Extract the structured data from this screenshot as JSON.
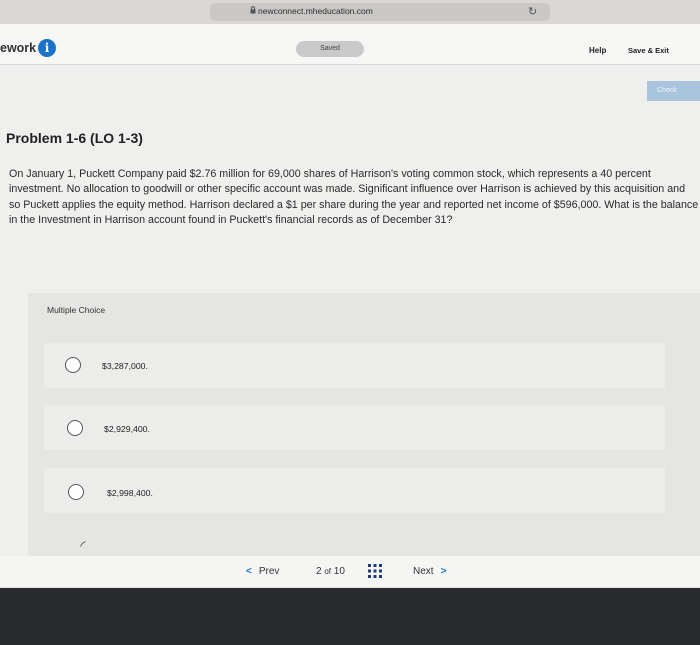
{
  "browser": {
    "url": "newconnect.mheducation.com"
  },
  "header": {
    "course_label": "ework",
    "saved_label": "Saved",
    "help_label": "Help",
    "save_exit_label": "Save & Exit",
    "check_label": "Check"
  },
  "problem": {
    "title": "Problem 1-6 (LO 1-3)",
    "text": "On January 1, Puckett Company paid $2.76 million for 69,000 shares of Harrison's voting common stock, which represents a 40 percent investment. No allocation to goodwill or other specific account was made. Significant influence over Harrison is achieved by this acquisition and so Puckett applies the equity method. Harrison declared a $1 per share during the year and reported net income of $596,000. What is the balance in the Investment in Harrison account found in Puckett's financial records as of December 31?"
  },
  "question": {
    "type_label": "Multiple Choice",
    "options": [
      {
        "label": "$3,287,000."
      },
      {
        "label": "$2,929,400."
      },
      {
        "label": "$2,998,400."
      }
    ]
  },
  "pager": {
    "prev_label": "Prev",
    "current": "2",
    "of_label": "of",
    "total": "10",
    "next_label": "Next"
  },
  "colors": {
    "accent": "#1a73c9",
    "check_button": "#a9c5de"
  }
}
